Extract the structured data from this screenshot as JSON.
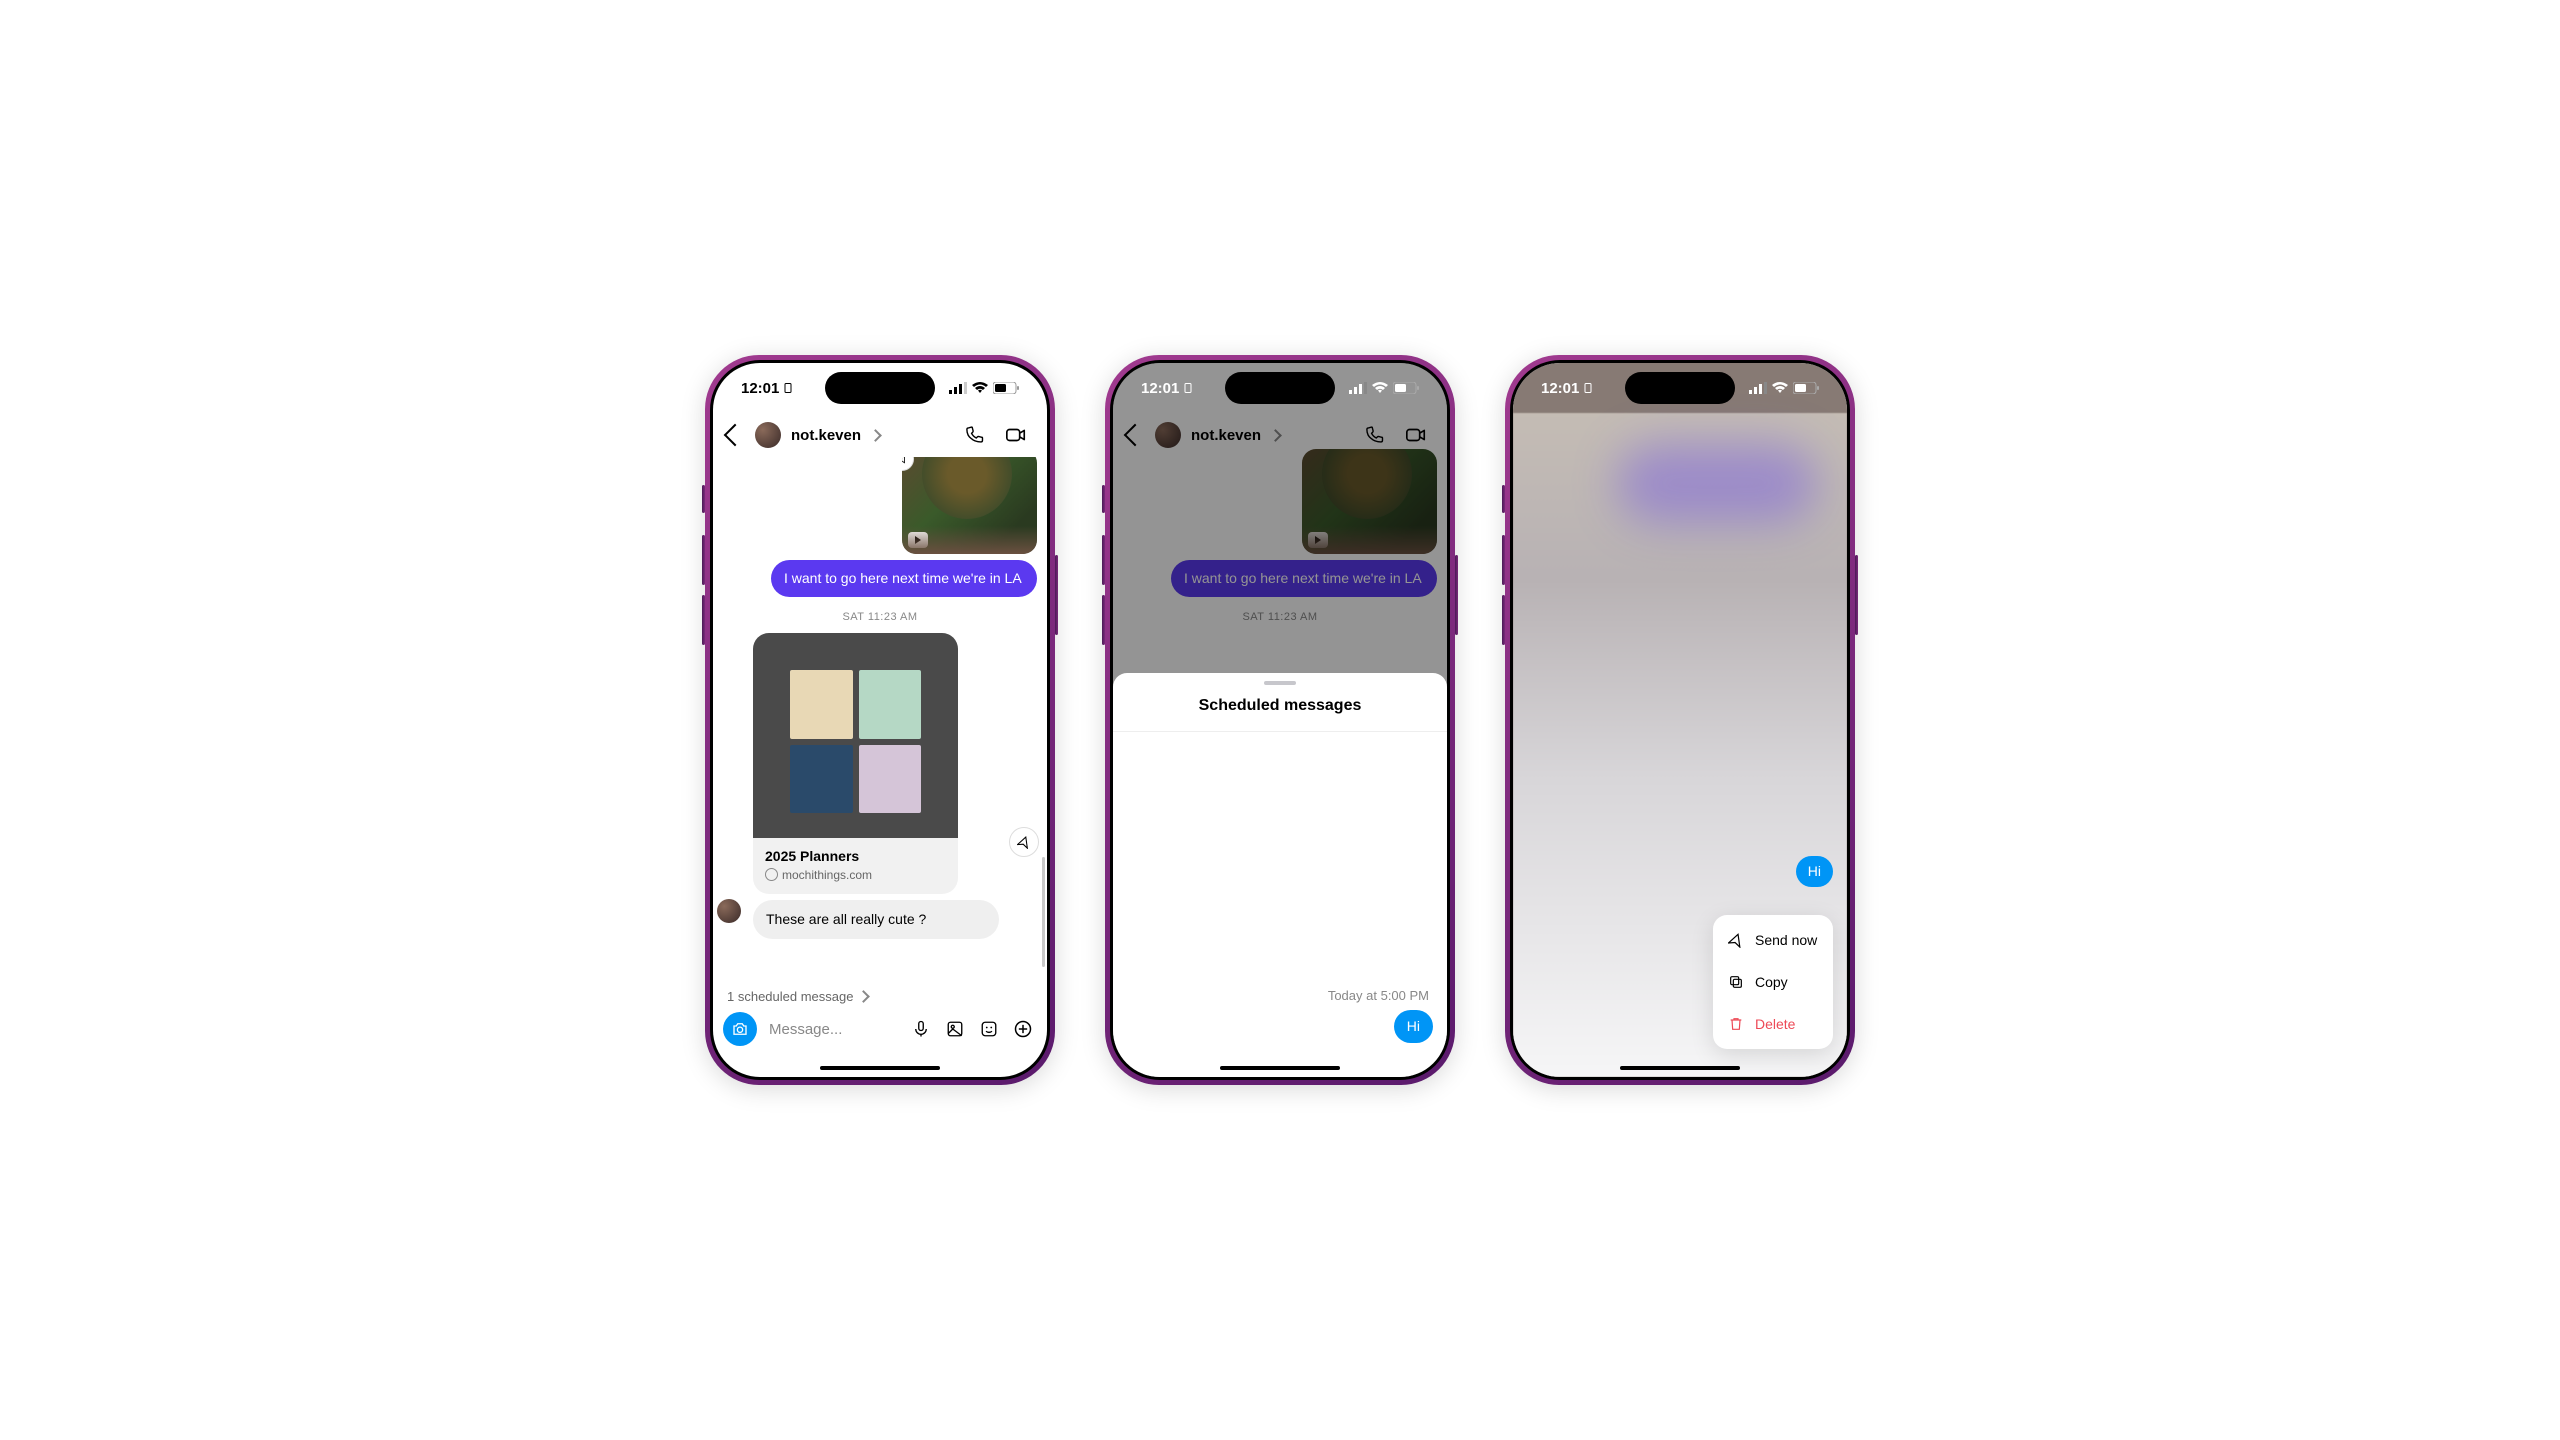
{
  "status": {
    "time": "12:01"
  },
  "chat": {
    "username": "not.keven",
    "sent_bubble": "I want to go here next time we're in LA",
    "timestamp": "SAT 11:23 AM",
    "link_title": "2025 Planners",
    "link_domain": "mochithings.com",
    "recv_bubble": "These are all really cute ?",
    "scheduled_banner": "1 scheduled message",
    "composer_placeholder": "Message..."
  },
  "sheet": {
    "title": "Scheduled messages",
    "schedule_time": "Today at 5:00 PM",
    "preview_text": "Hi"
  },
  "context_menu": {
    "preview_text": "Hi",
    "send_now": "Send now",
    "copy": "Copy",
    "delete": "Delete"
  }
}
